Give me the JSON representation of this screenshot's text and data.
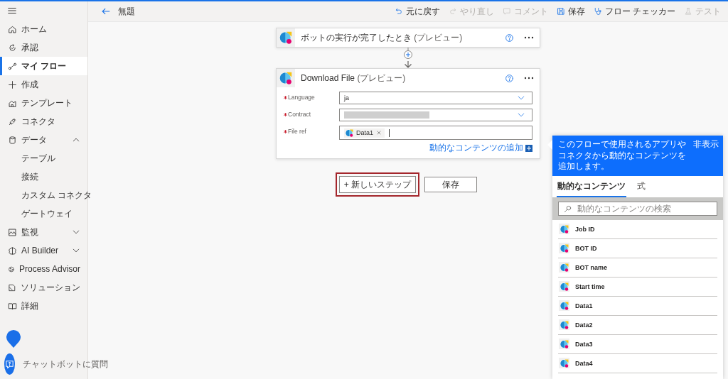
{
  "sidebar": {
    "items": [
      {
        "label": "ホーム",
        "selected": false
      },
      {
        "label": "承認",
        "selected": false
      },
      {
        "label": "マイ フロー",
        "selected": true
      },
      {
        "label": "作成",
        "selected": false
      },
      {
        "label": "テンプレート",
        "selected": false
      },
      {
        "label": "コネクタ",
        "selected": false
      },
      {
        "label": "データ",
        "selected": false,
        "expanded": true,
        "children": [
          {
            "label": "テーブル",
            "selected": false
          },
          {
            "label": "接続",
            "selected": false
          },
          {
            "label": "カスタム コネクタ",
            "selected": false
          },
          {
            "label": "ゲートウェイ",
            "selected": false
          }
        ]
      },
      {
        "label": "監視",
        "selected": false,
        "expanded": false
      },
      {
        "label": "AI Builder",
        "selected": false,
        "expanded": false
      },
      {
        "label": "Process Advisor",
        "selected": false
      },
      {
        "label": "ソリューション",
        "selected": false
      },
      {
        "label": "詳細",
        "selected": false
      }
    ],
    "chat": {
      "label": "チャットボットに質問"
    }
  },
  "toolbar": {
    "title": "無題",
    "actions": [
      {
        "label": "元に戻す",
        "disabled": false
      },
      {
        "label": "やり直し",
        "disabled": true
      },
      {
        "label": "コメント",
        "disabled": true
      },
      {
        "label": "保存",
        "disabled": false
      },
      {
        "label": "フロー チェッカー",
        "disabled": false
      },
      {
        "label": "テスト",
        "disabled": true
      }
    ]
  },
  "flow": {
    "steps": [
      {
        "title": "ボットの実行が完了したとき",
        "suffix": "(プレビュー)",
        "expanded": false
      },
      {
        "title": "Download File",
        "suffix": "(プレビュー)",
        "expanded": true,
        "fields": [
          {
            "label": "Language",
            "required": true,
            "kind": "dropdown",
            "value": "ja"
          },
          {
            "label": "Contract",
            "required": true,
            "kind": "dropdown",
            "redacted": true
          },
          {
            "label": "File ref",
            "required": true,
            "kind": "tokens",
            "tokens": [
              "Data1"
            ]
          }
        ],
        "add_dynamic": "動的なコンテンツの追加"
      }
    ],
    "buttons": [
      {
        "label": "+ 新しいステップ",
        "highlighted": true
      },
      {
        "label": "保存",
        "highlighted": false
      }
    ]
  },
  "panel": {
    "message": "このフローで使用されるアプリやコネクタから動的なコンテンツを追加します。",
    "hide": "非表示",
    "tabs": [
      {
        "label": "動的なコンテンツ",
        "selected": true
      },
      {
        "label": "式",
        "selected": false
      }
    ],
    "search": {
      "placeholder": "動的なコンテンツの検索"
    },
    "items": [
      "Job ID",
      "BOT ID",
      "BOT name",
      "Start time",
      "Data1",
      "Data2",
      "Data3",
      "Data4"
    ]
  }
}
